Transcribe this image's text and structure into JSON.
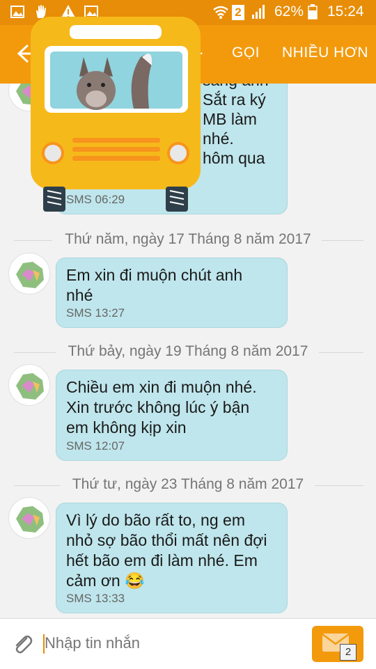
{
  "status_bar": {
    "battery": "62%",
    "time": "15:24",
    "sim": "2"
  },
  "toolbar": {
    "title_partial": "...",
    "call": "GỌI",
    "more": "NHIỀU HƠN"
  },
  "messages_top": {
    "lines": [
      "sang anh",
      "Sắt ra ký",
      "MB làm",
      "nhé.",
      "hôm qua"
    ],
    "meta": "SMS 06:29"
  },
  "thread": [
    {
      "date": "Thứ năm, ngày 17 Tháng 8 năm 2017",
      "text": "Em xin đi muộn chút anh\nnhé",
      "meta": "SMS 13:27"
    },
    {
      "date": "Thứ bảy, ngày 19 Tháng 8 năm 2017",
      "text": "Chiều em xin đi muộn nhé.\nXin trước không lúc ý bận\nem không kịp xin",
      "meta": "SMS 12:07"
    },
    {
      "date": "Thứ tư, ngày 23 Tháng 8 năm 2017",
      "text": "Vì lý do bão rất to, ng em\nnhỏ sợ bão thổi mất nên đợi\nhết bão em đi làm nhé. Em\ncảm ơn 😂",
      "meta": "SMS 13:33"
    }
  ],
  "composer": {
    "placeholder": "Nhập tin nhắn",
    "send_badge": "2"
  }
}
